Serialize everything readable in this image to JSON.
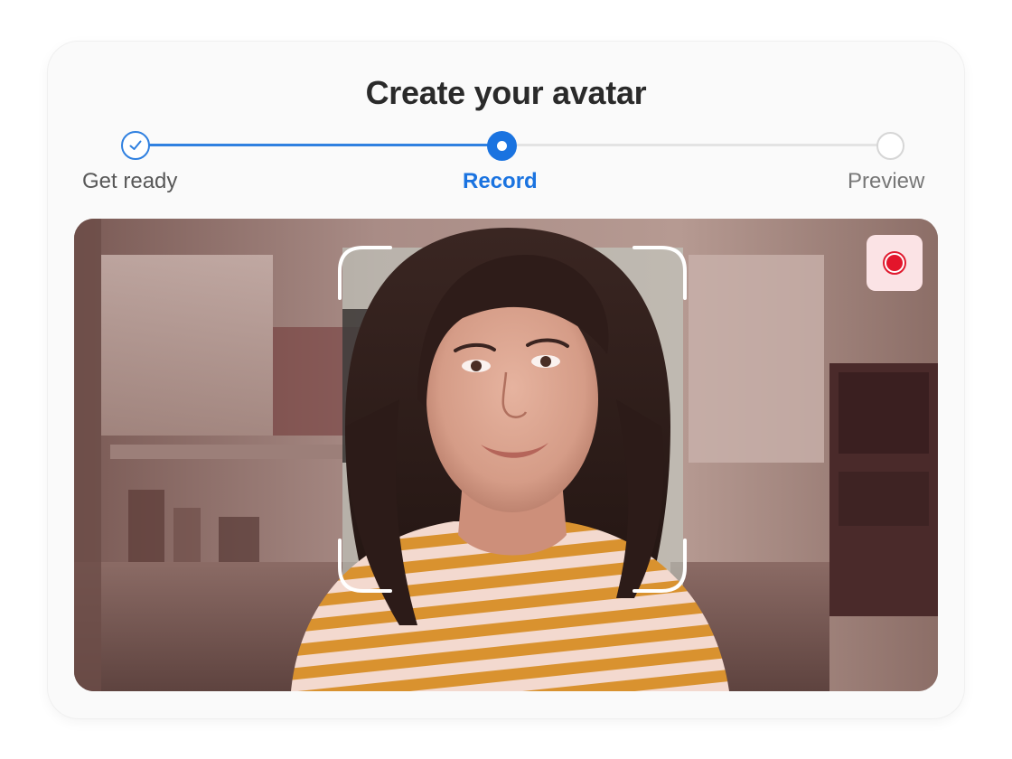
{
  "header": {
    "title": "Create your avatar"
  },
  "stepper": {
    "steps": [
      {
        "label": "Get ready",
        "state": "complete"
      },
      {
        "label": "Record",
        "state": "active"
      },
      {
        "label": "Preview",
        "state": "pending"
      }
    ],
    "colors": {
      "active": "#1a73e0",
      "complete": "#2f80e0",
      "pending": "#d6d6d6"
    }
  },
  "camera": {
    "state": "live",
    "face_frame": "face-guide-corners",
    "record_button": {
      "icon": "record-icon",
      "color": "#e3152b",
      "background": "#fbe3e5"
    }
  }
}
